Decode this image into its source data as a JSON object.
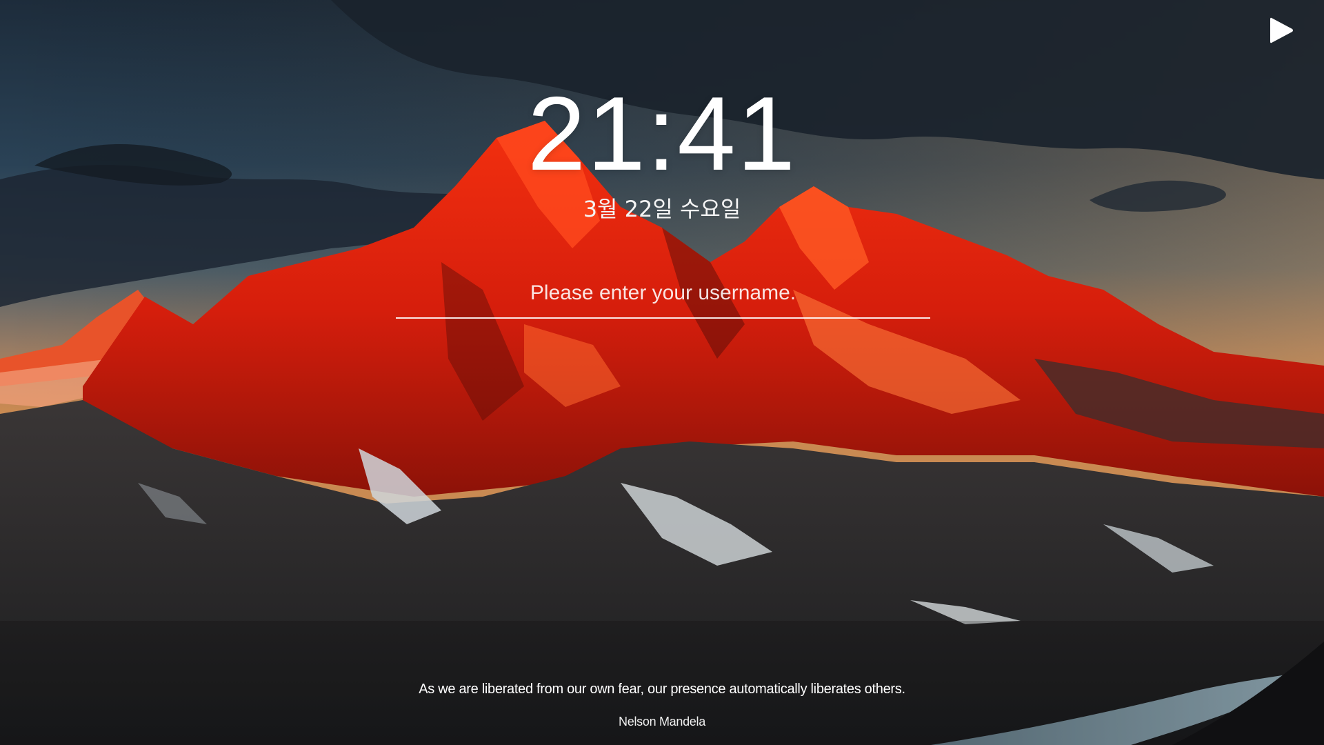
{
  "clock": {
    "time": "21:41"
  },
  "date": {
    "label": "3월 22일 수요일"
  },
  "login": {
    "username_placeholder": "Please enter your username.",
    "username_value": ""
  },
  "controls": {
    "play_icon": "play-icon"
  },
  "quote": {
    "text": "As we are liberated from our own fear, our presence automatically liberates others.",
    "author": "Nelson Mandela"
  },
  "colors": {
    "sky_top": "#1e2f40",
    "sky_horizon": "#c98a52",
    "peak_red": "#e8200e",
    "text": "#ffffff"
  }
}
